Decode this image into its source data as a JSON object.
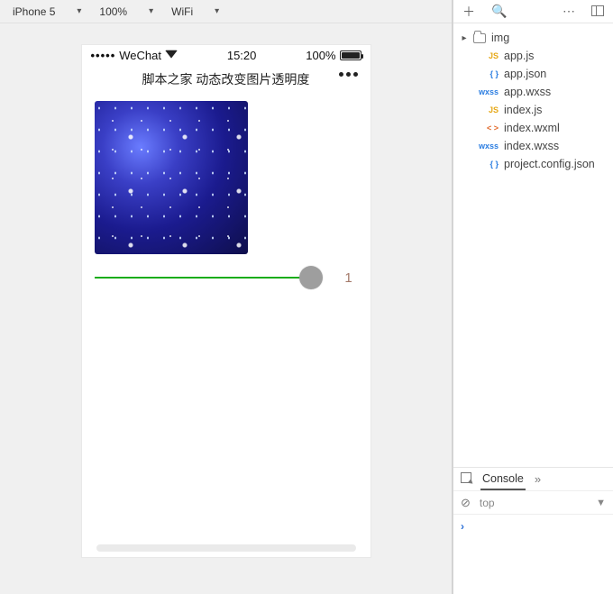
{
  "device_bar": {
    "device": "iPhone 5",
    "zoom": "100%",
    "network": "WiFi"
  },
  "status_bar": {
    "carrier": "WeChat",
    "time": "15:20",
    "battery_pct": "100%"
  },
  "nav": {
    "title": "脚本之家 动态改变图片透明度"
  },
  "slider": {
    "value": "1"
  },
  "file_tree": {
    "folder": "img",
    "files": [
      {
        "icon": "js",
        "name": "app.js"
      },
      {
        "icon": "json",
        "name": "app.json"
      },
      {
        "icon": "wxss",
        "name": "app.wxss"
      },
      {
        "icon": "js",
        "name": "index.js"
      },
      {
        "icon": "wxml",
        "name": "index.wxml"
      },
      {
        "icon": "wxss",
        "name": "index.wxss"
      },
      {
        "icon": "json",
        "name": "project.config.json"
      }
    ]
  },
  "bottom_panel": {
    "tab": "Console",
    "context": "top"
  }
}
